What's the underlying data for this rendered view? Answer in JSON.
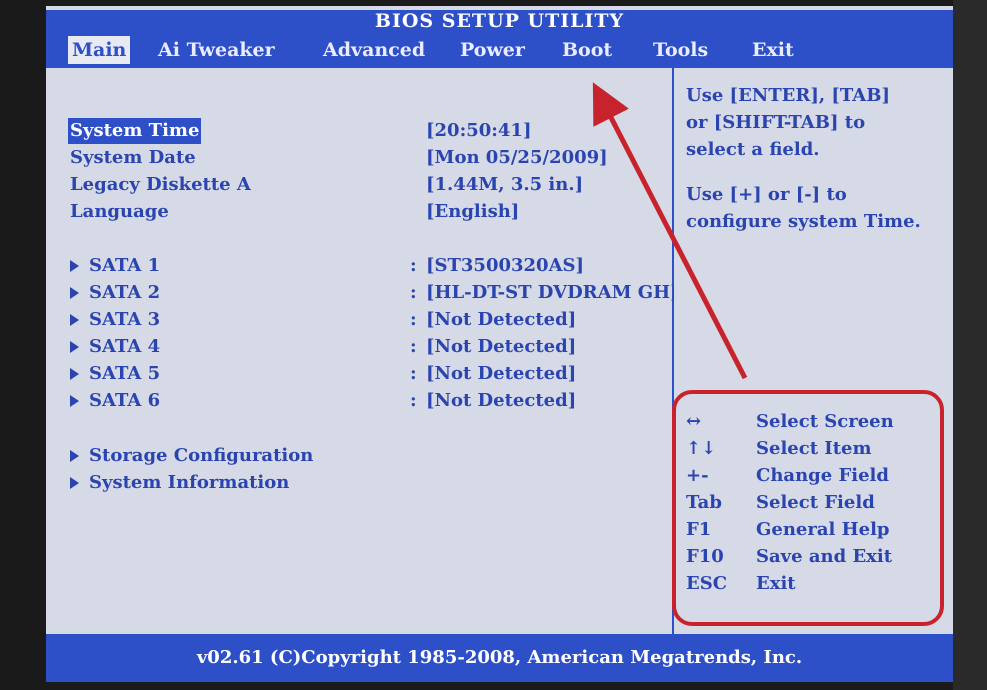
{
  "title": "BIOS SETUP UTILITY",
  "menu": [
    {
      "label": "Main",
      "active": true
    },
    {
      "label": "Ai Tweaker"
    },
    {
      "label": "Advanced"
    },
    {
      "label": "Power"
    },
    {
      "label": "Boot"
    },
    {
      "label": "Tools"
    },
    {
      "label": "Exit"
    }
  ],
  "main": {
    "settings": [
      {
        "label": "System Time",
        "value": "[20:50:41]"
      },
      {
        "label": "System Date",
        "value": "[Mon 05/25/2009]"
      },
      {
        "label": "Legacy Diskette A",
        "value": "[1.44M, 3.5 in.]"
      },
      {
        "label": "Language",
        "value": "[English]"
      }
    ],
    "sata": [
      {
        "label": "SATA 1",
        "value": "[ST3500320AS]"
      },
      {
        "label": "SATA 2",
        "value": "[HL-DT-ST DVDRAM GH]"
      },
      {
        "label": "SATA 3",
        "value": "[Not Detected]"
      },
      {
        "label": "SATA 4",
        "value": "[Not Detected]"
      },
      {
        "label": "SATA 5",
        "value": "[Not Detected]"
      },
      {
        "label": "SATA 6",
        "value": "[Not Detected]"
      }
    ],
    "submenus": [
      {
        "label": "Storage Configuration"
      },
      {
        "label": "System Information"
      }
    ]
  },
  "help": {
    "line1": "Use [ENTER], [TAB]",
    "line2": "or [SHIFT-TAB] to",
    "line3": "select a field.",
    "line4": "Use [+] or [-] to",
    "line5": "configure system Time."
  },
  "keys": [
    {
      "key": "↔",
      "desc": "Select Screen"
    },
    {
      "key": "↑↓",
      "desc": "Select Item"
    },
    {
      "key": "+-",
      "desc": "Change Field"
    },
    {
      "key": "Tab",
      "desc": "Select Field"
    },
    {
      "key": "F1",
      "desc": "General Help"
    },
    {
      "key": "F10",
      "desc": "Save and Exit"
    },
    {
      "key": "ESC",
      "desc": "Exit"
    }
  ],
  "footer": "v02.61 (C)Copyright 1985-2008, American Megatrends, Inc.",
  "colors": {
    "bios_blue": "#2d4fc7",
    "panel": "#d6d9e6",
    "annotation_red": "#c8232c"
  }
}
